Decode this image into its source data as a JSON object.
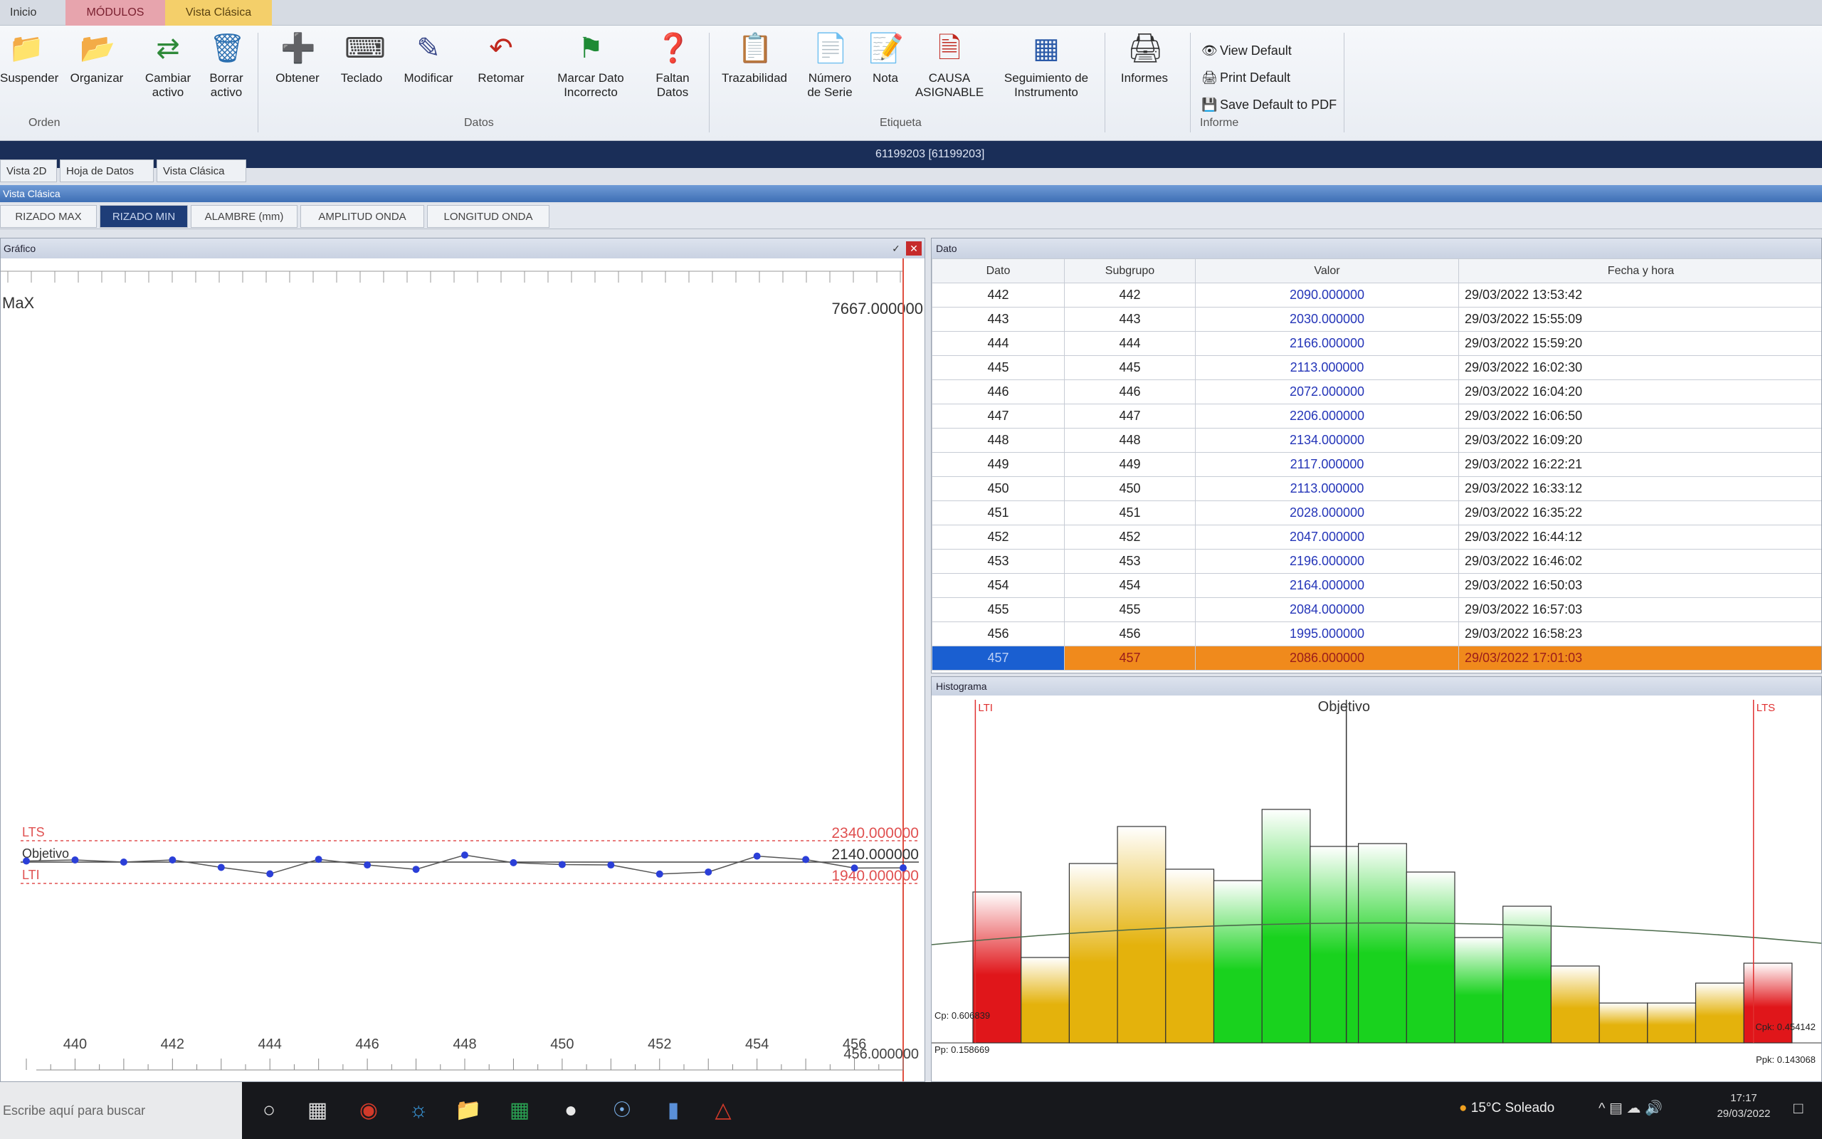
{
  "top_tabs": [
    "Inicio",
    "MÓDULOS",
    "Vista Clásica"
  ],
  "ribbon": {
    "buttons": [
      {
        "label": "Suspender",
        "icon": "folder-icon"
      },
      {
        "label": "Organizar",
        "icon": "folder-icon"
      },
      {
        "label": "Cambiar activo",
        "icon": "swap-icon"
      },
      {
        "label": "Borrar activo",
        "icon": "trash-icon"
      },
      {
        "label": "Obtener",
        "icon": "add-icon"
      },
      {
        "label": "Teclado",
        "icon": "keyboard-icon"
      },
      {
        "label": "Modificar",
        "icon": "edit-icon"
      },
      {
        "label": "Retomar",
        "icon": "undo-icon"
      },
      {
        "label": "Marcar Dato Incorrecto",
        "icon": "flag-icon"
      },
      {
        "label": "Faltan Datos",
        "icon": "help-icon"
      },
      {
        "label": "Trazabilidad",
        "icon": "clipboard-icon"
      },
      {
        "label": "Número de Serie",
        "icon": "serial-icon"
      },
      {
        "label": "Nota",
        "icon": "note-icon"
      },
      {
        "label": "CAUSA ASIGNABLE",
        "icon": "document-icon"
      },
      {
        "label": "Seguimiento de Instrumento",
        "icon": "instrument-icon"
      },
      {
        "label": "Informes",
        "icon": "printer-icon"
      }
    ],
    "groups": [
      "Orden",
      "Datos",
      "Etiqueta",
      "Informe"
    ],
    "small_buttons": [
      "View Default",
      "Print Default",
      "Save Default to PDF"
    ]
  },
  "title_bar": "61199203 [61199203]",
  "view_tabs": [
    "Vista 2D",
    "Hoja de Datos",
    "Vista Clásica"
  ],
  "sub_bar": "Vista Clásica",
  "chart_tabs": [
    "RIZADO MAX",
    "RIZADO MIN",
    "ALAMBRE (mm)",
    "AMPLITUD ONDA",
    "LONGITUD ONDA"
  ],
  "left_panel": {
    "header": "Gráfico",
    "corner_label": "MaX",
    "top_value": "7667.000000",
    "lts_value": "2340.000000",
    "target_value": "2140.000000",
    "lti_value": "1940.000000",
    "x_end_value": "456.000000",
    "line_labels": {
      "lts": "LTS",
      "target": "Objetivo",
      "lti": "LTI"
    }
  },
  "table": {
    "header": "Dato",
    "columns": [
      "Dato",
      "Subgrupo",
      "Valor",
      "Fecha y hora"
    ],
    "rows": [
      [
        "442",
        "442",
        "2090.000000",
        "29/03/2022 13:53:42"
      ],
      [
        "443",
        "443",
        "2030.000000",
        "29/03/2022 15:55:09"
      ],
      [
        "444",
        "444",
        "2166.000000",
        "29/03/2022 15:59:20"
      ],
      [
        "445",
        "445",
        "2113.000000",
        "29/03/2022 16:02:30"
      ],
      [
        "446",
        "446",
        "2072.000000",
        "29/03/2022 16:04:20"
      ],
      [
        "447",
        "447",
        "2206.000000",
        "29/03/2022 16:06:50"
      ],
      [
        "448",
        "448",
        "2134.000000",
        "29/03/2022 16:09:20"
      ],
      [
        "449",
        "449",
        "2117.000000",
        "29/03/2022 16:22:21"
      ],
      [
        "450",
        "450",
        "2113.000000",
        "29/03/2022 16:33:12"
      ],
      [
        "451",
        "451",
        "2028.000000",
        "29/03/2022 16:35:22"
      ],
      [
        "452",
        "452",
        "2047.000000",
        "29/03/2022 16:44:12"
      ],
      [
        "453",
        "453",
        "2196.000000",
        "29/03/2022 16:46:02"
      ],
      [
        "454",
        "454",
        "2164.000000",
        "29/03/2022 16:50:03"
      ],
      [
        "455",
        "455",
        "2084.000000",
        "29/03/2022 16:57:03"
      ],
      [
        "456",
        "456",
        "1995.000000",
        "29/03/2022 16:58:23"
      ],
      [
        "457",
        "457",
        "2086.000000",
        "29/03/2022 17:01:03"
      ]
    ],
    "selected_row": 15
  },
  "histogram": {
    "header": "Histograma",
    "labels": {
      "lti": "LTI",
      "target": "Objetivo",
      "lts": "LTS"
    },
    "stats": {
      "cp": "Cp: 0.606839",
      "pp": "Pp: 0.158669",
      "cpk": "Cpk: 0.454142",
      "ppk": "Ppk: 0.143068"
    }
  },
  "chart_data": [
    {
      "type": "line",
      "title": "",
      "x": [
        439,
        440,
        441,
        442,
        443,
        444,
        445,
        446,
        447,
        448,
        449,
        450,
        451,
        452,
        453,
        454,
        455,
        456,
        457
      ],
      "series": [
        {
          "values": [
            2150,
            2160,
            2140,
            2160,
            2090,
            2030,
            2166,
            2113,
            2072,
            2206,
            2134,
            2117,
            2113,
            2028,
            2047,
            2196,
            2164,
            2084,
            2086
          ]
        }
      ],
      "xticks": [
        440,
        442,
        444,
        446,
        448,
        450,
        452,
        454,
        456
      ],
      "reference_lines": {
        "LTS": 2340,
        "Objetivo": 2140,
        "LTI": 1940
      },
      "ylim": [
        0,
        7667
      ],
      "xlim": [
        439,
        457
      ]
    },
    {
      "type": "bar",
      "title": "",
      "categories": [
        "1",
        "2",
        "3",
        "4",
        "5",
        "6",
        "7",
        "8",
        "9",
        "10",
        "11",
        "12",
        "13",
        "14",
        "15",
        "16",
        "17"
      ],
      "values": [
        53,
        30,
        63,
        76,
        61,
        57,
        82,
        69,
        70,
        60,
        37,
        48,
        27,
        14,
        14,
        21,
        28
      ],
      "bar_zones": [
        "red",
        "yellow",
        "yellow",
        "yellow",
        "yellow-green",
        "green",
        "green",
        "green",
        "green",
        "green",
        "green",
        "green-yellow",
        "yellow",
        "yellow",
        "yellow",
        "yellow",
        "red"
      ],
      "reference_lines": {
        "LTI": 1.05,
        "Objetivo": 8.75,
        "LTS": 17.2
      }
    }
  ],
  "taskbar": {
    "search_text": "Escribe aquí para buscar",
    "weather": "15°C  Soleado",
    "time": "17:17",
    "date": "29/03/2022"
  },
  "colors": {
    "ribbon_title": "#1a2e58",
    "active_tab": "#1e3d78",
    "spec_line": "#e03030",
    "series_point": "#2b3fd8",
    "selected_row": "#f08a1c",
    "hist_red": "#e0161a",
    "hist_yellow": "#e4b20c",
    "hist_green": "#19d21e"
  }
}
